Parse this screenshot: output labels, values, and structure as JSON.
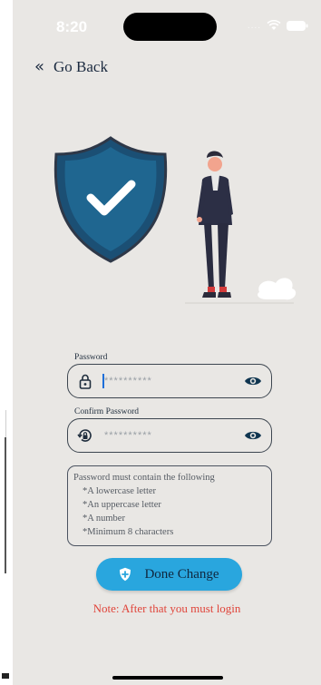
{
  "status_bar": {
    "time": "8:20"
  },
  "nav": {
    "back_label": "Go Back"
  },
  "password_field": {
    "label": "Password",
    "placeholder": "**********"
  },
  "confirm_field": {
    "label": "Confirm Password",
    "placeholder": "**********"
  },
  "rules": {
    "title": "Password must contain the following",
    "items": [
      "*A lowercase letter",
      "*An uppercase letter",
      "*A number",
      "*Minimum 8 characters"
    ]
  },
  "done_button": {
    "label": "Done Change"
  },
  "note": "Note: After that you must login",
  "icons": {
    "back": "double-chevron-left-icon",
    "lock": "lock-icon",
    "reset_lock": "lock-reset-icon",
    "eye": "eye-icon",
    "shield_plus": "shield-plus-icon",
    "wifi": "wifi-icon",
    "battery": "battery-icon"
  },
  "colors": {
    "background": "#e9e7e4",
    "primary_button": "#29a6de",
    "note_text": "#e0443a",
    "shield": "#1f5e86",
    "dark_text": "#1c2b40"
  }
}
